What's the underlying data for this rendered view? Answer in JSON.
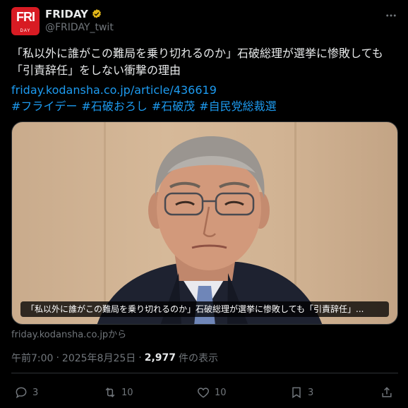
{
  "author": {
    "display_name": "FRIDAY",
    "handle": "@FRIDAY_twit",
    "avatar_main": "FRI",
    "avatar_sub": "DAY"
  },
  "tweet": {
    "text": "「私以外に誰がこの難局を乗り切れるのか」石破総理が選挙に惨敗しても「引責辞任」をしない衝撃の理由",
    "link": "friday.kodansha.co.jp/article/436619",
    "hashtags": [
      "#フライデー",
      "#石破おろし",
      "#石破茂",
      "#自民党総裁選"
    ]
  },
  "card": {
    "caption": "「私以外に誰がこの難局を乗り切れるのか」石破総理が選挙に惨敗しても「引責辞任」...",
    "source": "friday.kodansha.co.jpから"
  },
  "meta": {
    "time": "午前7:00",
    "date": "2025年8月25日",
    "views": "2,977",
    "views_label": "件の表示"
  },
  "actions": {
    "replies": "3",
    "retweets": "10",
    "likes": "10",
    "bookmarks": "3"
  },
  "colors": {
    "accent": "#1d9bf0",
    "verified": "#e2b719",
    "brand": "#d81b23"
  }
}
